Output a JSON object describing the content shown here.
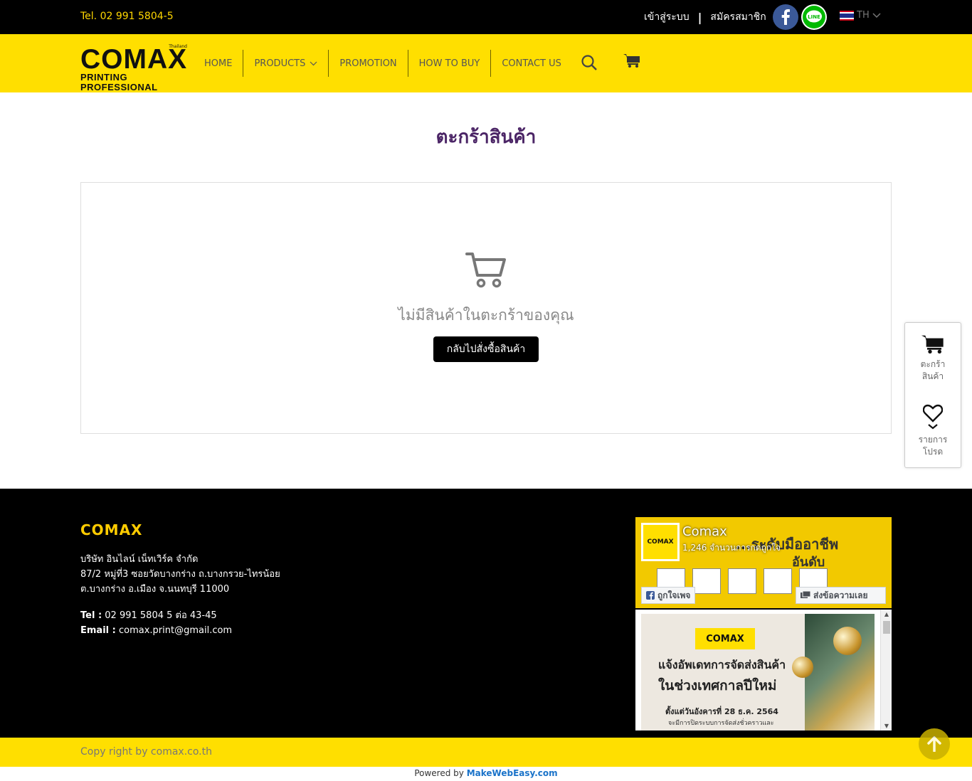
{
  "topbar": {
    "tel": "Tel. 02 991 5804-5",
    "login": "เข้าสู่ระบบ",
    "separator": "|",
    "register": "สมัครสมาชิก",
    "lang": "TH",
    "facebook_icon": "facebook-icon",
    "line_icon": "line-icon",
    "line_label": "LINE"
  },
  "logo": {
    "brand": "COMAX",
    "sub": "PRINTING PROFESSIONAL",
    "tm": "Thailand"
  },
  "nav": {
    "items": [
      {
        "label": "HOME"
      },
      {
        "label": "PRODUCTS"
      },
      {
        "label": "PROMOTION"
      },
      {
        "label": "HOW TO BUY"
      },
      {
        "label": "CONTACT US"
      }
    ]
  },
  "page": {
    "title": "ตะกร้าสินค้า",
    "empty_text": "ไม่มีสินค้าในตะกร้าของคุณ",
    "back_button": "กลับไปสั่งซื้อสินค้า"
  },
  "side_widget": {
    "cart_line1": "ตะกร้า",
    "cart_line2": "สินค้า",
    "wish_line1": "รายการ",
    "wish_line2": "โปรด"
  },
  "footer": {
    "brand": "COMAX",
    "company": "บริษัท อินไลน์ เน็ทเวิร์ค จำกัด",
    "address1": "87/2 หมู่ที่3 ซอยวัดบางกร่าง ถ.บางกรวย-ไทรน้อย",
    "address2": "ต.บางกร่าง อ.เมือง จ.นนทบุรี 11000",
    "tel_label": "Tel :",
    "tel_value": "02 991 5804 5 ต่อ 43-45",
    "email_label": "Email :",
    "email_value": "comax.print@gmail.com",
    "fb_page_name": "Comax",
    "fb_likes": "1,246 จำนวนการกดถูกใจ",
    "fb_like_button": "ถูกใจเพจ",
    "fb_message_button": "ส่งข้อความเลย",
    "fb_banner_text": "...ระดับมืออาชีพ",
    "fb_banner_text2": "อันดับ",
    "fb_avatar": "COMAX",
    "post_logo": "COMAX",
    "post_h1": "แจ้งอัพเดทการจัดส่งสินค้า",
    "post_h2": "ในช่วงเทศกาลปีใหม่",
    "post_h3": "ตั้งแต่วันอังคารที่ 28 ธ.ค. 2564",
    "post_h4": "จะมีการปิดระบบการจัดส่งชั่วคราวและ"
  },
  "copyright": "Copy right by comax.co.th",
  "powered_prefix": "Powered by",
  "powered_brand": "MakeWebEasy.com",
  "colors": {
    "topbar_bg": "#000000",
    "header_bg": "#ffdf00",
    "title_color": "#4b2566",
    "footer_brand": "#ffcc00"
  }
}
